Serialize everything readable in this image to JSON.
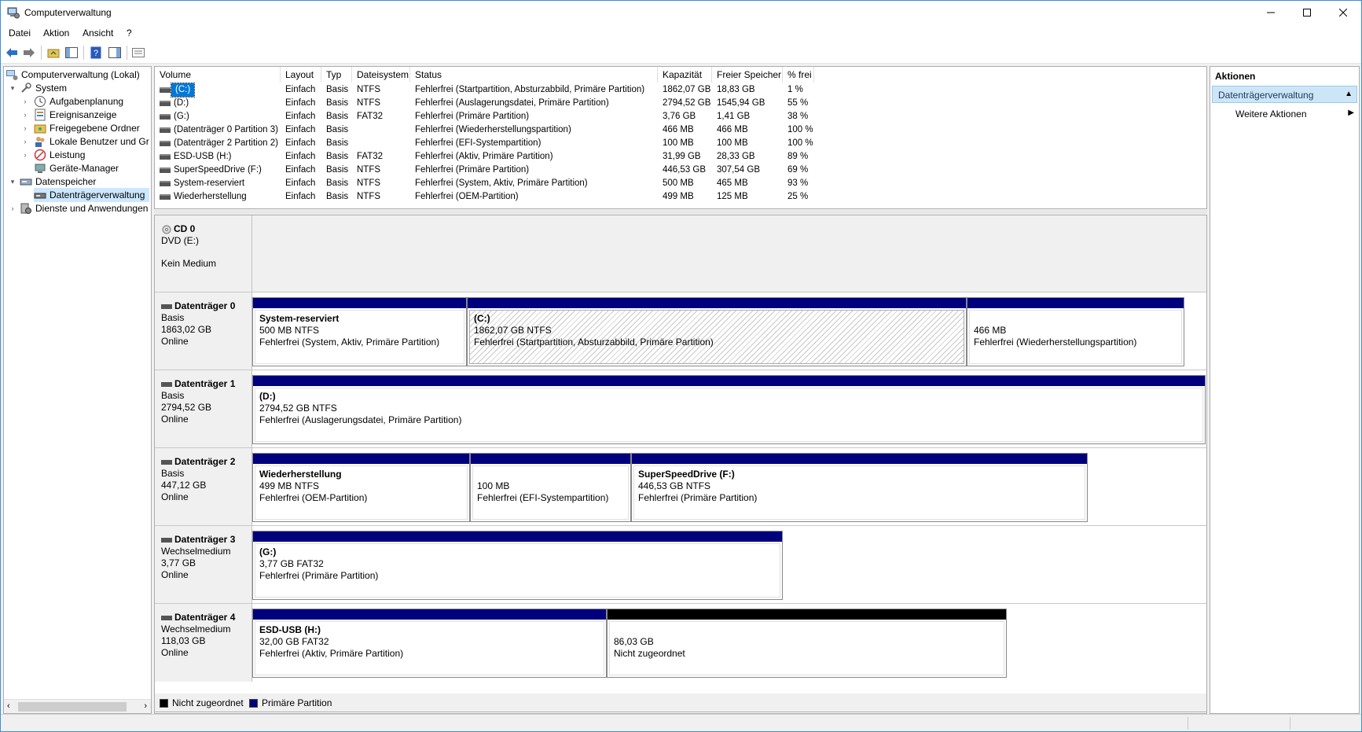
{
  "window": {
    "title": "Computerverwaltung"
  },
  "menu": [
    "Datei",
    "Aktion",
    "Ansicht",
    "?"
  ],
  "tree": {
    "root": "Computerverwaltung (Lokal)",
    "items": [
      {
        "label": "System",
        "icon": "tools-icon"
      },
      {
        "label": "Aufgabenplanung",
        "icon": "clock-icon"
      },
      {
        "label": "Ereignisanzeige",
        "icon": "event-viewer-icon"
      },
      {
        "label": "Freigegebene Ordner",
        "icon": "shared-folder-icon"
      },
      {
        "label": "Lokale Benutzer und Gr",
        "icon": "users-icon"
      },
      {
        "label": "Leistung",
        "icon": "performance-icon"
      },
      {
        "label": "Geräte-Manager",
        "icon": "device-manager-icon"
      },
      {
        "label": "Datenspeicher",
        "icon": "storage-icon"
      },
      {
        "label": "Datenträgerverwaltung",
        "icon": "disk-management-icon"
      },
      {
        "label": "Dienste und Anwendungen",
        "icon": "services-icon"
      }
    ]
  },
  "volumes": {
    "columns": [
      "Volume",
      "Layout",
      "Typ",
      "Dateisystem",
      "Status",
      "Kapazität",
      "Freier Speicher",
      "% frei"
    ],
    "rows": [
      [
        "(C:)",
        "Einfach",
        "Basis",
        "NTFS",
        "Fehlerfrei (Startpartition, Absturzabbild, Primäre Partition)",
        "1862,07 GB",
        "18,83 GB",
        "1 %"
      ],
      [
        "(D:)",
        "Einfach",
        "Basis",
        "NTFS",
        "Fehlerfrei (Auslagerungsdatei, Primäre Partition)",
        "2794,52 GB",
        "1545,94 GB",
        "55 %"
      ],
      [
        "(G:)",
        "Einfach",
        "Basis",
        "FAT32",
        "Fehlerfrei (Primäre Partition)",
        "3,76 GB",
        "1,41 GB",
        "38 %"
      ],
      [
        "(Datenträger 0 Partition 3)",
        "Einfach",
        "Basis",
        "",
        "Fehlerfrei (Wiederherstellungspartition)",
        "466 MB",
        "466 MB",
        "100 %"
      ],
      [
        "(Datenträger 2 Partition 2)",
        "Einfach",
        "Basis",
        "",
        "Fehlerfrei (EFI-Systempartition)",
        "100 MB",
        "100 MB",
        "100 %"
      ],
      [
        "ESD-USB (H:)",
        "Einfach",
        "Basis",
        "FAT32",
        "Fehlerfrei (Aktiv, Primäre Partition)",
        "31,99 GB",
        "28,33 GB",
        "89 %"
      ],
      [
        "SuperSpeedDrive (F:)",
        "Einfach",
        "Basis",
        "NTFS",
        "Fehlerfrei (Primäre Partition)",
        "446,53 GB",
        "307,54 GB",
        "69 %"
      ],
      [
        "System-reserviert",
        "Einfach",
        "Basis",
        "NTFS",
        "Fehlerfrei (System, Aktiv, Primäre Partition)",
        "500 MB",
        "465 MB",
        "93 %"
      ],
      [
        "Wiederherstellung",
        "Einfach",
        "Basis",
        "NTFS",
        "Fehlerfrei (OEM-Partition)",
        "499 MB",
        "125 MB",
        "25 %"
      ]
    ]
  },
  "disks": [
    {
      "name": "CD 0",
      "type": "DVD (E:)",
      "size": "",
      "state": "Kein Medium",
      "partitions": []
    },
    {
      "name": "Datenträger 0",
      "type": "Basis",
      "size": "1863,02 GB",
      "state": "Online",
      "partitions": [
        {
          "name": "System-reserviert",
          "size": "500 MB NTFS",
          "status": "Fehlerfrei (System, Aktiv, Primäre Partition)"
        },
        {
          "name": "(C:)",
          "size": "1862,07 GB NTFS",
          "status": "Fehlerfrei (Startpartition, Absturzabbild, Primäre Partition)"
        },
        {
          "name": "",
          "size": "466 MB",
          "status": "Fehlerfrei (Wiederherstellungspartition)"
        }
      ]
    },
    {
      "name": "Datenträger 1",
      "type": "Basis",
      "size": "2794,52 GB",
      "state": "Online",
      "partitions": [
        {
          "name": "(D:)",
          "size": "2794,52 GB NTFS",
          "status": "Fehlerfrei (Auslagerungsdatei, Primäre Partition)"
        }
      ]
    },
    {
      "name": "Datenträger 2",
      "type": "Basis",
      "size": "447,12 GB",
      "state": "Online",
      "partitions": [
        {
          "name": "Wiederherstellung",
          "size": "499 MB NTFS",
          "status": "Fehlerfrei (OEM-Partition)"
        },
        {
          "name": "",
          "size": "100 MB",
          "status": "Fehlerfrei (EFI-Systempartition)"
        },
        {
          "name": "SuperSpeedDrive  (F:)",
          "size": "446,53 GB NTFS",
          "status": "Fehlerfrei (Primäre Partition)"
        }
      ]
    },
    {
      "name": "Datenträger 3",
      "type": "Wechselmedium",
      "size": "3,77 GB",
      "state": "Online",
      "partitions": [
        {
          "name": "(G:)",
          "size": "3,77 GB FAT32",
          "status": "Fehlerfrei (Primäre Partition)"
        }
      ]
    },
    {
      "name": "Datenträger 4",
      "type": "Wechselmedium",
      "size": "118,03 GB",
      "state": "Online",
      "partitions": [
        {
          "name": "ESD-USB  (H:)",
          "size": "32,00 GB FAT32",
          "status": "Fehlerfrei (Aktiv, Primäre Partition)"
        },
        {
          "name": "",
          "size": "86,03 GB",
          "status": "Nicht zugeordnet"
        }
      ]
    }
  ],
  "legend": [
    {
      "label": "Nicht zugeordnet",
      "color": "#000000"
    },
    {
      "label": "Primäre Partition",
      "color": "#00007d"
    }
  ],
  "actions": {
    "title": "Aktionen",
    "section": "Datenträgerverwaltung",
    "more": "Weitere Aktionen"
  },
  "colors": {
    "primary_partition": "#00007d",
    "unallocated": "#000000",
    "selection": "#0078d7"
  }
}
